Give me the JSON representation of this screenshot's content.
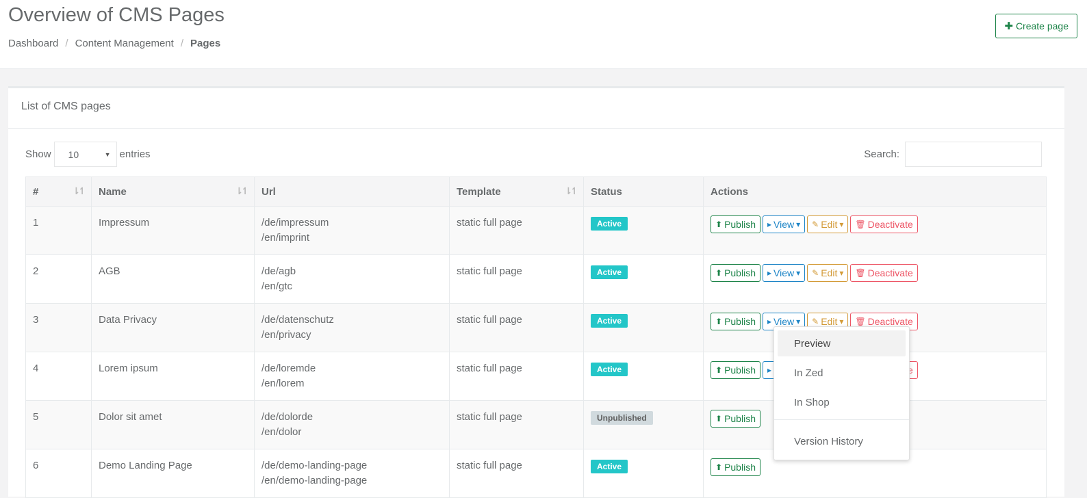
{
  "header": {
    "title": "Overview of CMS Pages",
    "breadcrumb": [
      "Dashboard",
      "Content Management",
      "Pages"
    ],
    "create_label": "Create page"
  },
  "panel": {
    "title": "List of CMS pages",
    "show_label": "Show",
    "entries_label": "entries",
    "length_value": "10",
    "search_label": "Search:"
  },
  "table": {
    "headers": [
      "#",
      "Name",
      "Url",
      "Template",
      "Status",
      "Actions"
    ],
    "rows": [
      {
        "id": "1",
        "name": "Impressum",
        "url1": "/de/impressum",
        "url2": "/en/imprint",
        "template": "static full page",
        "status": "Active"
      },
      {
        "id": "2",
        "name": "AGB",
        "url1": "/de/agb",
        "url2": "/en/gtc",
        "template": "static full page",
        "status": "Active"
      },
      {
        "id": "3",
        "name": "Data Privacy",
        "url1": "/de/datenschutz",
        "url2": "/en/privacy",
        "template": "static full page",
        "status": "Active"
      },
      {
        "id": "4",
        "name": "Lorem ipsum",
        "url1": "/de/loremde",
        "url2": "/en/lorem",
        "template": "static full page",
        "status": "Active"
      },
      {
        "id": "5",
        "name": "Dolor sit amet",
        "url1": "/de/dolorde",
        "url2": "/en/dolor",
        "template": "static full page",
        "status": "Unpublished"
      },
      {
        "id": "6",
        "name": "Demo Landing Page",
        "url1": "/de/demo-landing-page",
        "url2": "/en/demo-landing-page",
        "template": "static full page",
        "status": "Active"
      }
    ],
    "actions": {
      "publish": "Publish",
      "view": "View",
      "edit": "Edit",
      "deactivate": "Deactivate"
    }
  },
  "dropdown": {
    "items": [
      "Preview",
      "In Zed",
      "In Shop"
    ],
    "footer_item": "Version History"
  },
  "colors": {
    "publish": "#1c8348",
    "view": "#1c84c6",
    "edit": "#d39a36",
    "deactivate": "#ed5565",
    "active_badge": "#23c6c8",
    "unpublished_badge": "#d1dade"
  }
}
